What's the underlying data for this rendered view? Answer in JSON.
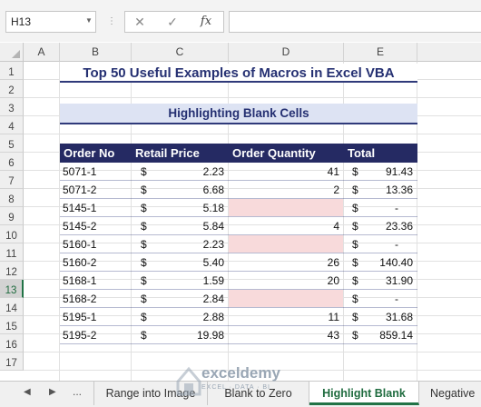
{
  "namebox": {
    "value": "H13"
  },
  "formula_bar": {
    "cancel_icon": "✕",
    "enter_icon": "✓",
    "fx_label": "fx",
    "value": ""
  },
  "columns": [
    "A",
    "B",
    "C",
    "D",
    "E"
  ],
  "rows": [
    "1",
    "2",
    "3",
    "4",
    "5",
    "6",
    "7",
    "8",
    "9",
    "10",
    "11",
    "12",
    "13",
    "14",
    "15",
    "16",
    "17"
  ],
  "selected_row": "13",
  "title": "Top 50 Useful Examples of Macros in Excel VBA",
  "subtitle": "Highlighting Blank Cells",
  "table": {
    "headers": [
      "Order No",
      "Retail Price",
      "Order Quantity",
      "Total"
    ],
    "currency_symbol": "$",
    "rows": [
      {
        "order": "5071-1",
        "price": "2.23",
        "qty": "41",
        "total": "91.43",
        "blank": false
      },
      {
        "order": "5071-2",
        "price": "6.68",
        "qty": "2",
        "total": "13.36",
        "blank": false
      },
      {
        "order": "5145-1",
        "price": "5.18",
        "qty": "",
        "total": "-",
        "blank": true
      },
      {
        "order": "5145-2",
        "price": "5.84",
        "qty": "4",
        "total": "23.36",
        "blank": false
      },
      {
        "order": "5160-1",
        "price": "2.23",
        "qty": "",
        "total": "-",
        "blank": true
      },
      {
        "order": "5160-2",
        "price": "5.40",
        "qty": "26",
        "total": "140.40",
        "blank": false
      },
      {
        "order": "5168-1",
        "price": "1.59",
        "qty": "20",
        "total": "31.90",
        "blank": false
      },
      {
        "order": "5168-2",
        "price": "2.84",
        "qty": "",
        "total": "-",
        "blank": true
      },
      {
        "order": "5195-1",
        "price": "2.88",
        "qty": "11",
        "total": "31.68",
        "blank": false
      },
      {
        "order": "5195-2",
        "price": "19.98",
        "qty": "43",
        "total": "859.14",
        "blank": false
      }
    ]
  },
  "sheet_tabs": {
    "nav": [
      "◀",
      "▶",
      "..."
    ],
    "tabs": [
      "Range into Image",
      "Blank to Zero",
      "Highlight Blank",
      "Negative"
    ],
    "active": "Highlight Blank"
  },
  "watermark": {
    "name": "exceldemy",
    "tagline": "EXCEL · DATA · BI"
  },
  "colors": {
    "header_fill": "#252a63",
    "blank_fill": "#f8dadb",
    "subtitle_fill": "#dde3f3",
    "accent": "#217346"
  }
}
